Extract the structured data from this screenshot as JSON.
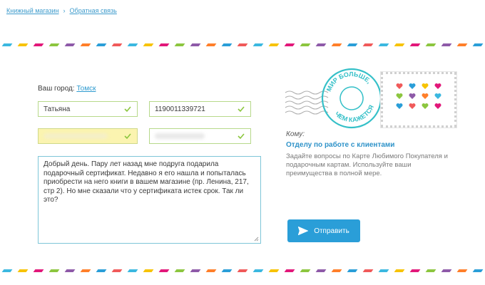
{
  "breadcrumb": {
    "home": "Книжный магазин",
    "current": "Обратная связь"
  },
  "form": {
    "city_label": "Ваш город:",
    "city_value": "Томск",
    "name_value": "Татьяна",
    "phone_value": "1190011339721",
    "message_text": "Добрый день. Пару лет назад мне подруга подарила подарочный сертификат. Недавно я его нашла и попыталась приобрести на него книги в вашем магазине (пр. Ленина, 217, стр 2). Но мне сказали что у сертификата истек срок. Так ли это?"
  },
  "recipient": {
    "to_label": "Кому:",
    "department": "Отделу по работе с клиентами",
    "description": "Задайте вопросы по Карте Любимого Покупателя и подарочным картам. Используйте ваши преимущества в полной мере."
  },
  "postmark": {
    "line1": "МИР БОЛЬШЕ,",
    "line2": "ЧЕМ КАЖЕТСЯ"
  },
  "send_button": {
    "label": "Отправить",
    "icon": "paper-plane-icon"
  },
  "colors": {
    "accent": "#2a9ed8",
    "link": "#3d9bcc",
    "field_border": "#b7d98a",
    "check": "#8cc63f",
    "stamp_ink": "#35c0c8",
    "stripe": [
      "#3bb8e0",
      "#f7c300",
      "#e2187a",
      "#8cc63f",
      "#8e5aa8",
      "#ff7f2a",
      "#2a9ed8",
      "#f05a5a"
    ],
    "hearts": [
      "#f05a5a",
      "#2a9ed8",
      "#f7c300",
      "#e2187a",
      "#8cc63f",
      "#8e5aa8",
      "#ff7f2a",
      "#3bb8e0",
      "#2a9ed8",
      "#f05a5a",
      "#8cc63f",
      "#e2187a"
    ]
  }
}
